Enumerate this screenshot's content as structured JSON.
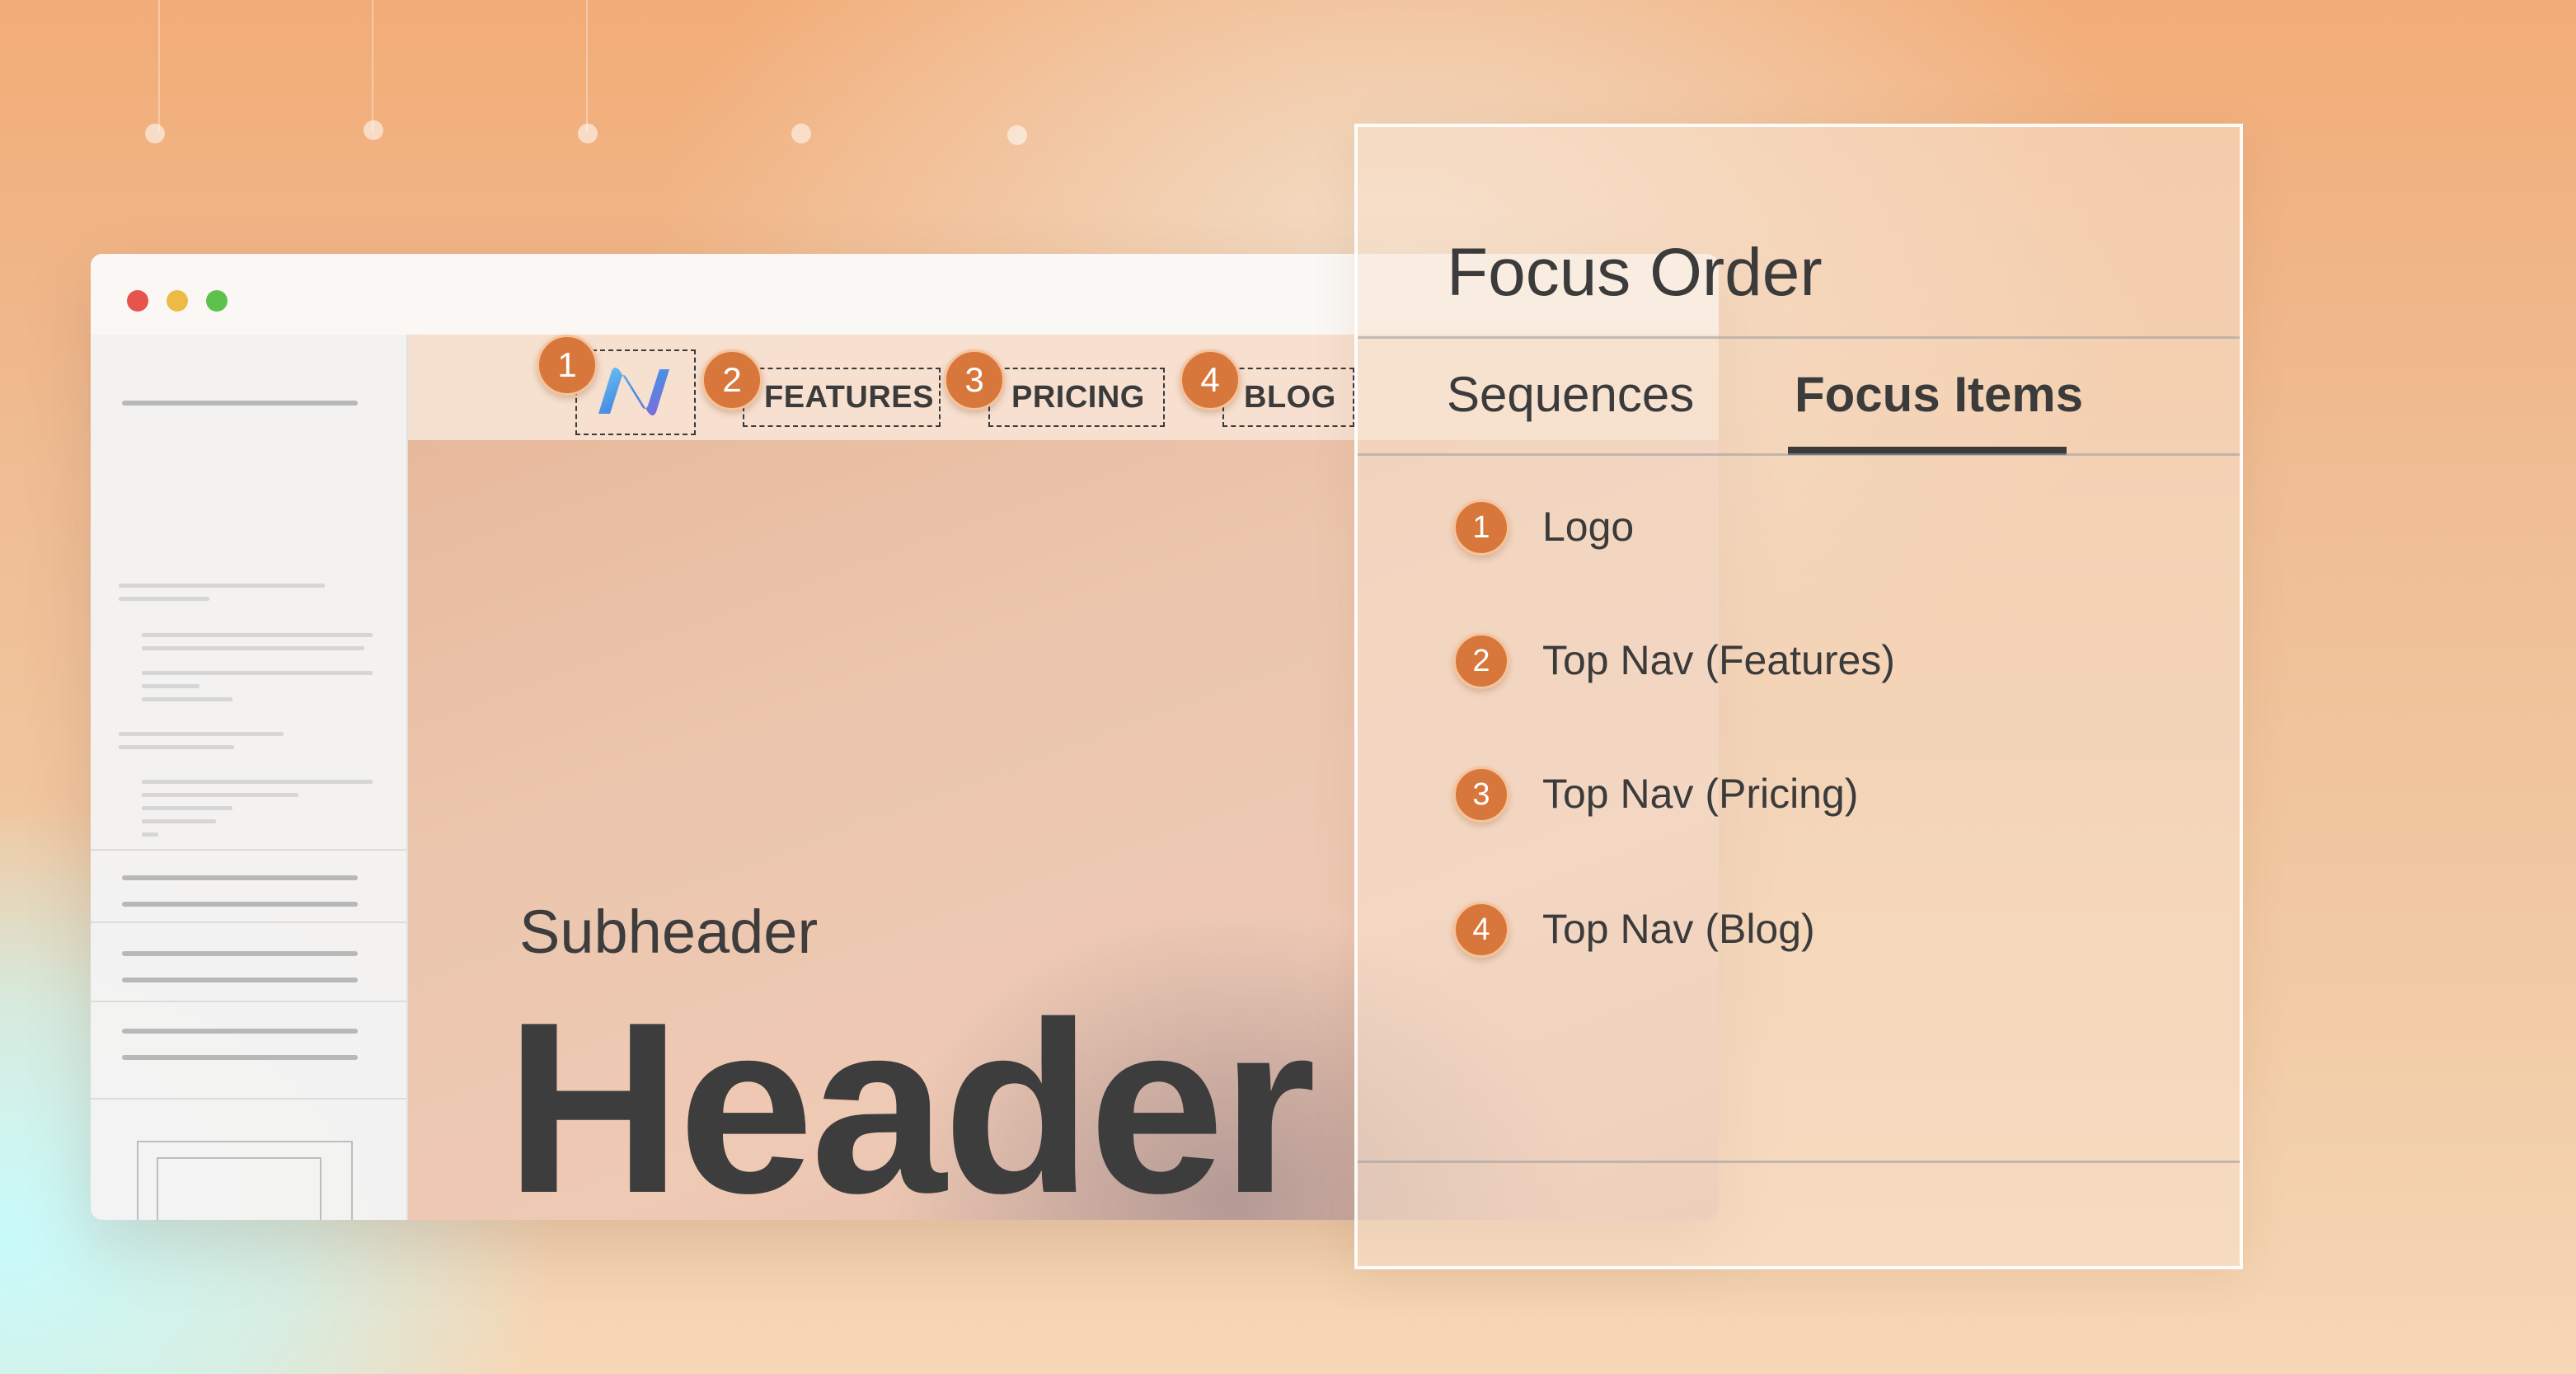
{
  "browser": {
    "controls": [
      "close",
      "minimize",
      "maximize"
    ]
  },
  "site": {
    "logo_icon": "wave-n-logo",
    "nav": [
      {
        "order": "1",
        "label": ""
      },
      {
        "order": "2",
        "label": "FEATURES"
      },
      {
        "order": "3",
        "label": "PRICING"
      },
      {
        "order": "4",
        "label": "BLOG"
      }
    ],
    "subheader": "Subheader",
    "header": "Header"
  },
  "panel": {
    "title": "Focus Order",
    "tabs": [
      {
        "label": "Sequences",
        "active": false
      },
      {
        "label": "Focus Items",
        "active": true
      }
    ],
    "items": [
      {
        "order": "1",
        "label": "Logo"
      },
      {
        "order": "2",
        "label": "Top Nav (Features)"
      },
      {
        "order": "3",
        "label": "Top Nav (Pricing)"
      },
      {
        "order": "4",
        "label": "Top Nav (Blog)"
      }
    ]
  },
  "colors": {
    "badge": "#d8773b",
    "text": "#3b3b3b"
  }
}
